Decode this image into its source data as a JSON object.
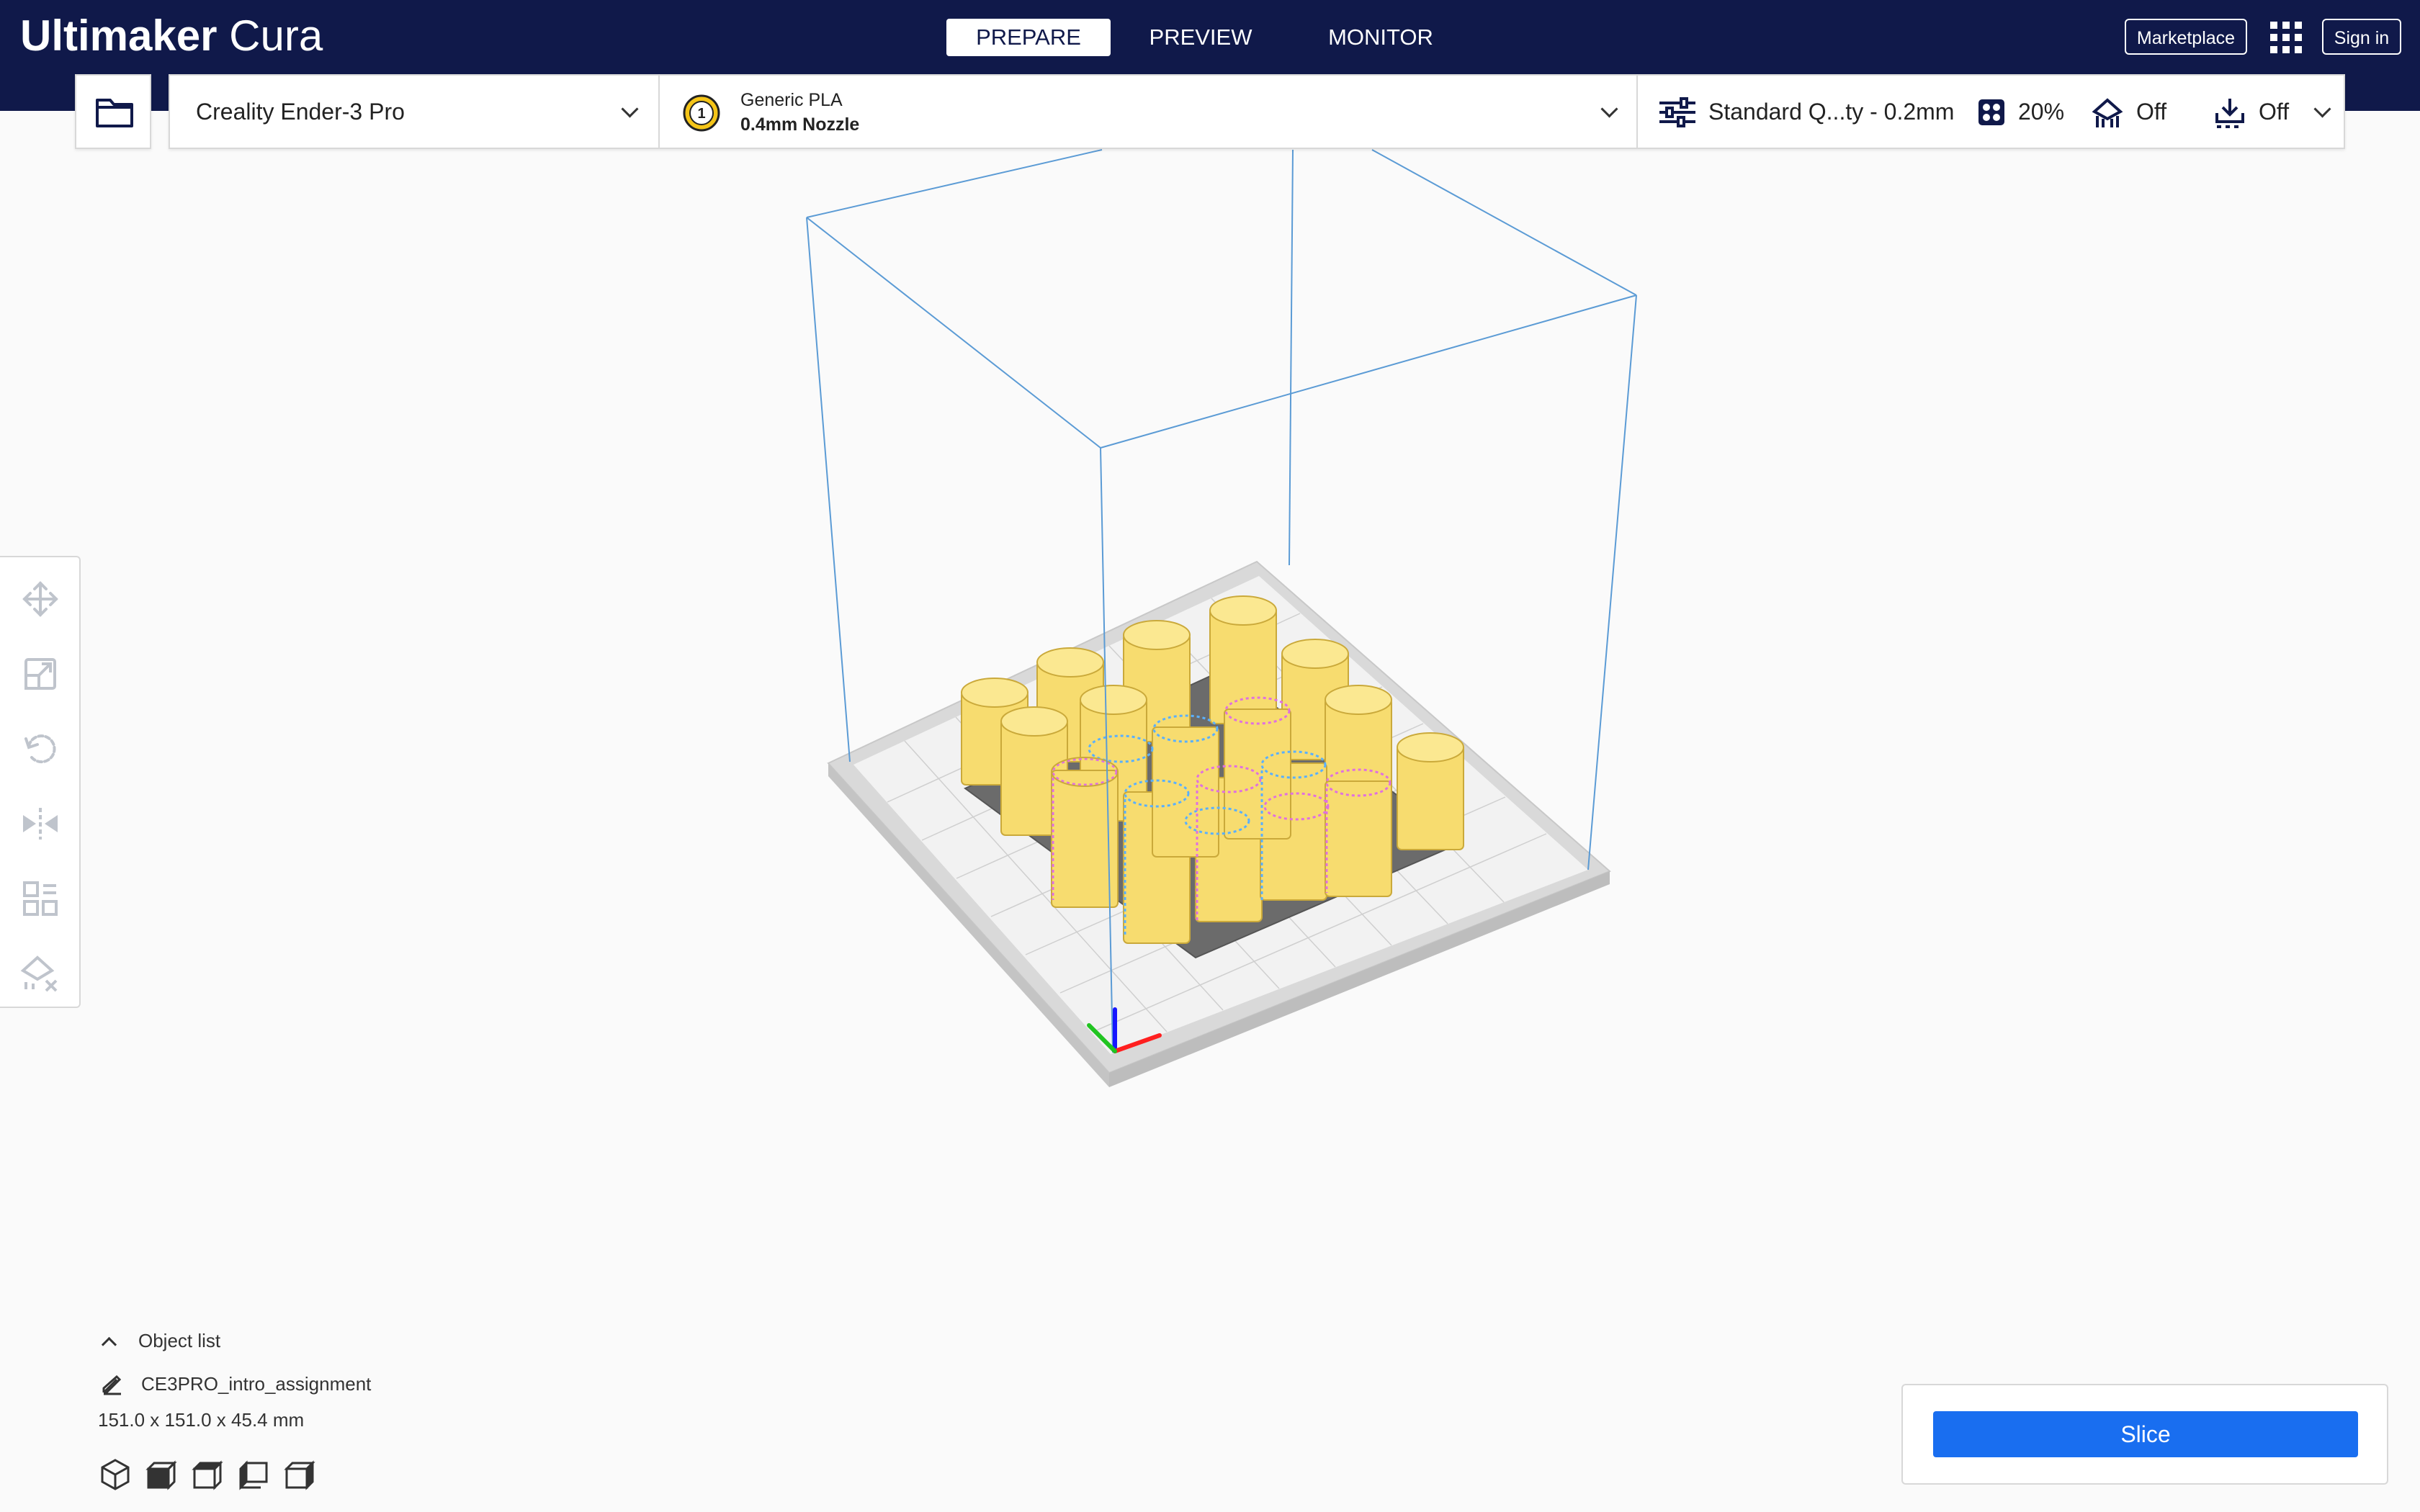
{
  "app": {
    "brand_bold": "Ultimaker",
    "brand_light": "Cura"
  },
  "stages": [
    {
      "label": "PREPARE",
      "active": true
    },
    {
      "label": "PREVIEW",
      "active": false
    },
    {
      "label": "MONITOR",
      "active": false
    }
  ],
  "header": {
    "marketplace_label": "Marketplace",
    "signin_label": "Sign in"
  },
  "toolbar": {
    "printer": "Creality Ender-3 Pro",
    "extruder_number": "1",
    "material": "Generic PLA",
    "nozzle": "0.4mm Nozzle",
    "profile": "Standard Q...ty - 0.2mm",
    "infill": "20%",
    "support": "Off",
    "adhesion": "Off"
  },
  "object_list": {
    "title": "Object list",
    "object_name": "CE3PRO_intro_assignment",
    "dimensions": "151.0 x 151.0 x 45.4 mm"
  },
  "slice": {
    "label": "Slice"
  },
  "colors": {
    "header": "#10194a",
    "accent": "#196ef0",
    "model": "#f7dc6f",
    "build_volume": "#5b9bd5",
    "extruder_badge": "#f5c518"
  },
  "icons": {
    "tools": [
      "move-icon",
      "scale-icon",
      "rotate-icon",
      "mirror-icon",
      "per-model-settings-icon",
      "support-blocker-icon"
    ],
    "views": [
      "3d-view-icon",
      "front-view-icon",
      "top-view-icon",
      "left-view-icon",
      "right-view-icon"
    ]
  }
}
